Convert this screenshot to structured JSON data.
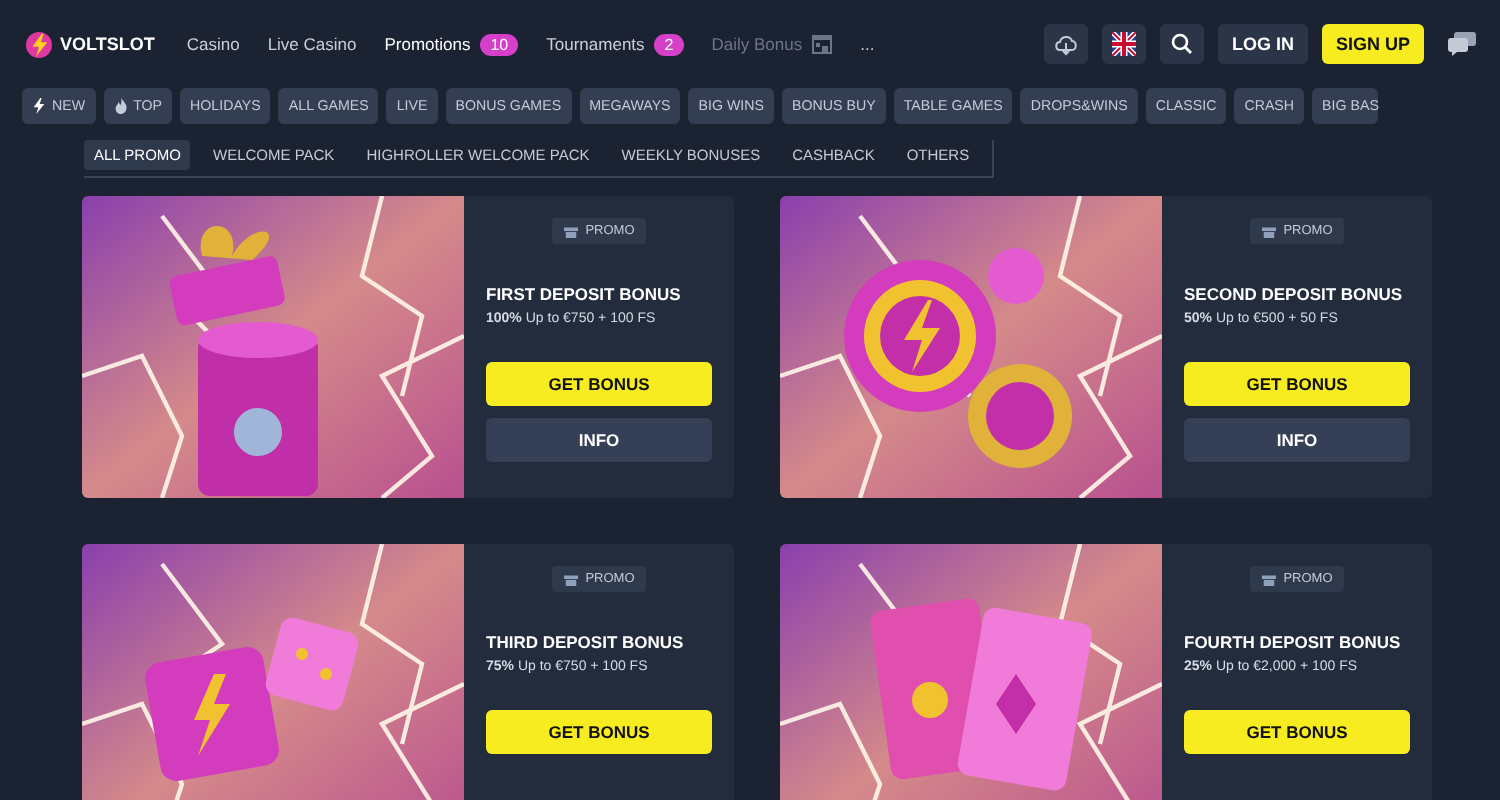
{
  "header": {
    "brand": "VOLTSLOT",
    "nav": [
      {
        "label": "Casino",
        "selected": false,
        "dim": false
      },
      {
        "label": "Live Casino",
        "selected": false,
        "dim": false
      },
      {
        "label": "Promotions",
        "selected": true,
        "dim": false,
        "badge": "10"
      },
      {
        "label": "Tournaments",
        "selected": false,
        "dim": false,
        "badge": "2"
      },
      {
        "label": "Daily Bonus",
        "selected": false,
        "dim": true
      },
      {
        "label": "...",
        "selected": false,
        "dim": false
      }
    ],
    "login": "LOG IN",
    "signup": "SIGN UP"
  },
  "categories": [
    {
      "label": "NEW"
    },
    {
      "label": "TOP"
    },
    {
      "label": "HOLIDAYS"
    },
    {
      "label": "ALL GAMES"
    },
    {
      "label": "LIVE"
    },
    {
      "label": "BONUS GAMES"
    },
    {
      "label": "MEGAWAYS"
    },
    {
      "label": "BIG WINS"
    },
    {
      "label": "BONUS BUY"
    },
    {
      "label": "TABLE GAMES"
    },
    {
      "label": "DROPS&WINS"
    },
    {
      "label": "CLASSIC"
    },
    {
      "label": "CRASH"
    },
    {
      "label": "BIG BAS"
    }
  ],
  "promo_tabs": [
    {
      "label": "ALL PROMO",
      "selected": true
    },
    {
      "label": "WELCOME PACK",
      "selected": false
    },
    {
      "label": "HIGHROLLER WELCOME PACK",
      "selected": false
    },
    {
      "label": "WEEKLY BONUSES",
      "selected": false
    },
    {
      "label": "CASHBACK",
      "selected": false
    },
    {
      "label": "OTHERS",
      "selected": false
    }
  ],
  "cards": [
    {
      "tag": "PROMO",
      "title": "FIRST DEPOSIT BONUS",
      "subtitle": "**100%** Up to €750 + 100 FS",
      "primary": "GET BONUS",
      "secondary": "INFO"
    },
    {
      "tag": "PROMO",
      "title": "SECOND DEPOSIT BONUS",
      "subtitle": "**50%** Up to €500 + 50 FS",
      "primary": "GET BONUS",
      "secondary": "INFO"
    },
    {
      "tag": "PROMO",
      "title": "THIRD DEPOSIT BONUS",
      "subtitle": "**75%** Up to €750 + 100 FS",
      "primary": "GET BONUS"
    },
    {
      "tag": "PROMO",
      "title": "FOURTH DEPOSIT BONUS",
      "subtitle": "**25%** Up to €2,000 + 100 FS",
      "primary": "GET BONUS"
    }
  ]
}
